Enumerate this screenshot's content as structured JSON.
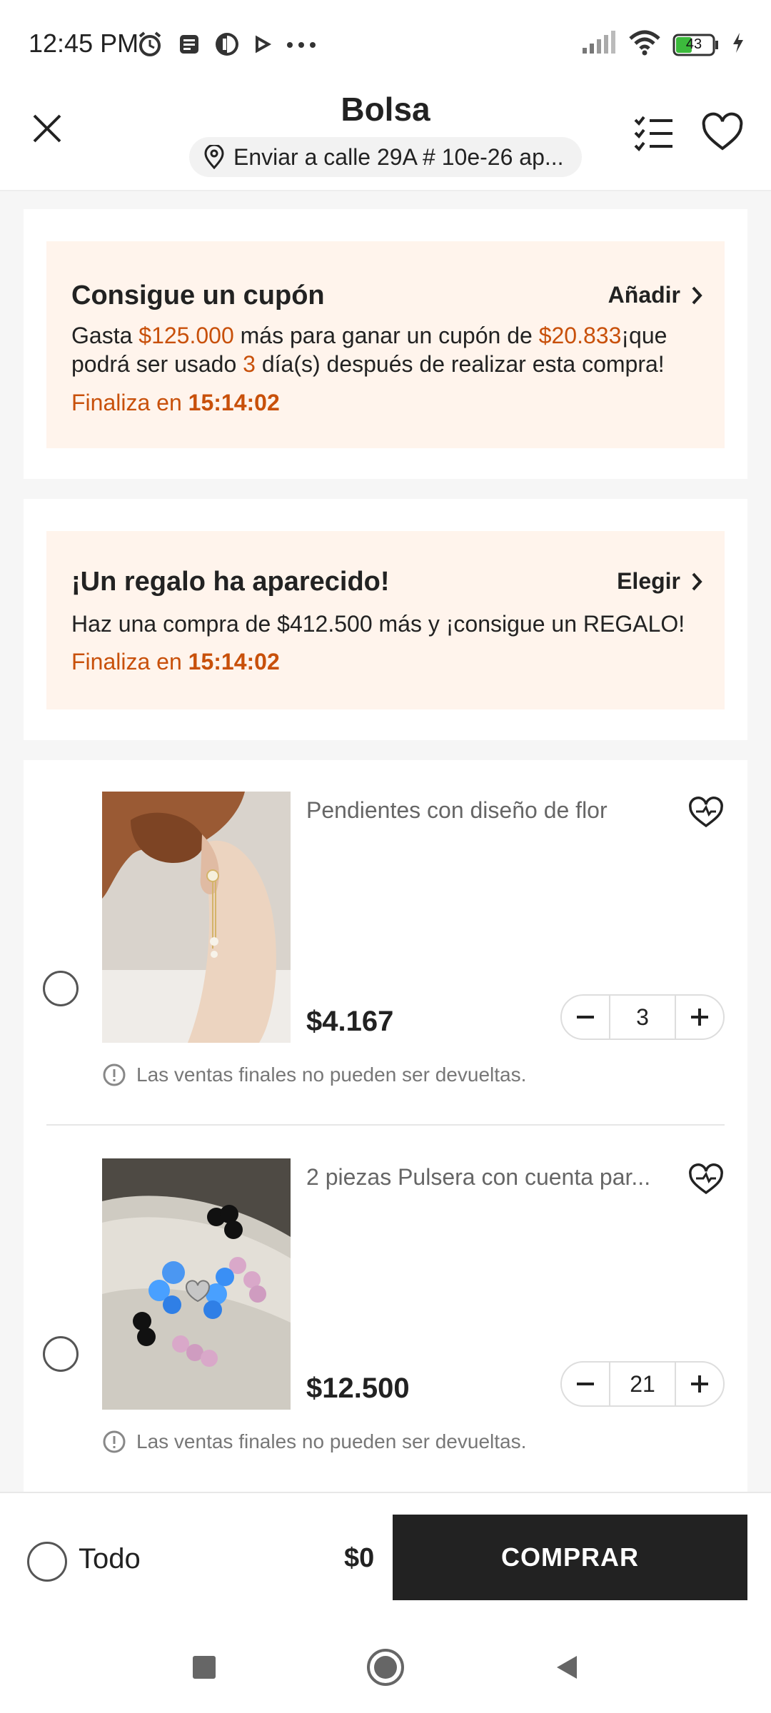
{
  "status_bar": {
    "time": "12:45 PM",
    "battery": "43",
    "left_icons": [
      "alarm-icon",
      "message-icon",
      "app-icon",
      "play-icon",
      "more-icon"
    ],
    "right_icons": [
      "signal-icon",
      "wifi-icon",
      "battery-icon",
      "charging-icon"
    ]
  },
  "header": {
    "title": "Bolsa",
    "shipping": "Enviar a calle 29A # 10e-26 ap..."
  },
  "coupon_promo": {
    "title": "Consigue un cupón",
    "action": "Añadir",
    "text_parts": [
      "Gasta ",
      "$125.000",
      " más para ganar un cupón de ",
      "$20.833",
      "¡que podrá ser usado ",
      "3",
      " día(s) después de realizar esta compra!"
    ],
    "ends_label": "Finaliza en ",
    "ends_time": "15:14:02"
  },
  "gift_promo": {
    "title": "¡Un regalo ha aparecido!",
    "action": "Elegir",
    "text": "Haz una compra de $412.500 más y ¡consigue un REGALO!",
    "ends_label": "Finaliza en ",
    "ends_time": "15:14:02"
  },
  "items": [
    {
      "name": "Pendientes con diseño de flor",
      "price": "$4.167",
      "quantity": "3",
      "note": "Las ventas finales no pueden ser devueltas."
    },
    {
      "name": "2 piezas Pulsera con cuenta par...",
      "price": "$12.500",
      "quantity": "21",
      "note": "Las ventas finales no pueden ser devueltas."
    }
  ],
  "bottom_bar": {
    "all_label": "Todo",
    "total": "$0",
    "buy_label": "COMPRAR"
  },
  "colors": {
    "accent_orange": "#c8500a",
    "promo_bg": "#fff4ec",
    "buy_button": "#222222"
  }
}
